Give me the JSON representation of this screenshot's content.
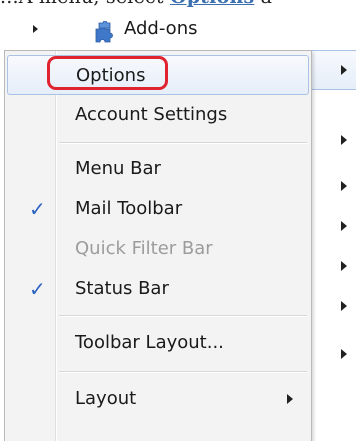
{
  "document": {
    "prefix_text": "...A menu, select ",
    "link_text": "Options",
    "suffix_text": " a"
  },
  "parent_menu": {
    "addons_label": "Add-ons",
    "addons_icon": "puzzle-piece-icon"
  },
  "submenu": {
    "options": "Options",
    "account_settings": "Account Settings",
    "menu_bar": "Menu Bar",
    "mail_toolbar": "Mail Toolbar",
    "quick_filter_bar": "Quick Filter Bar",
    "status_bar": "Status Bar",
    "toolbar_layout": "Toolbar Layout...",
    "layout": "Layout"
  },
  "state": {
    "mail_toolbar_checked": true,
    "status_bar_checked": true,
    "quick_filter_bar_disabled": true,
    "highlighted_item": "Options"
  },
  "colors": {
    "highlight_ring": "#e0242f",
    "check_mark": "#2b63c4",
    "link": "#3a6fb0",
    "hover_border": "#a9c2e4"
  }
}
